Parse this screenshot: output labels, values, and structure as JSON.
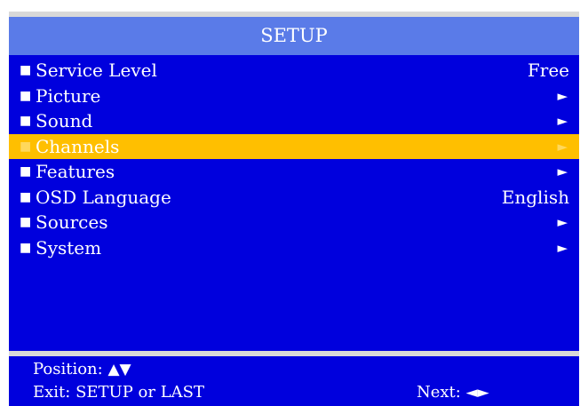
{
  "title": "SETUP",
  "menu": {
    "items": [
      {
        "label": "Service Level",
        "value": "Free",
        "arrow": ""
      },
      {
        "label": "Picture",
        "value": "",
        "arrow": "►"
      },
      {
        "label": "Sound",
        "value": "",
        "arrow": "►"
      },
      {
        "label": "Channels",
        "value": "",
        "arrow": "►"
      },
      {
        "label": "Features",
        "value": "",
        "arrow": "►"
      },
      {
        "label": "OSD Language",
        "value": "English",
        "arrow": ""
      },
      {
        "label": "Sources",
        "value": "",
        "arrow": "►"
      },
      {
        "label": "System",
        "value": "",
        "arrow": "►"
      }
    ],
    "selected_index": 3,
    "bullet": "■"
  },
  "footer": {
    "position_label": "Position:",
    "position_keys": "▲▼",
    "exit_text": "Exit: SETUP or LAST",
    "next_label": "Next:",
    "next_keys": "◄►"
  },
  "colors": {
    "background": "#0000dd",
    "title_bar": "#5a7be8",
    "highlight": "#ffbf00",
    "text": "#ffffff"
  }
}
